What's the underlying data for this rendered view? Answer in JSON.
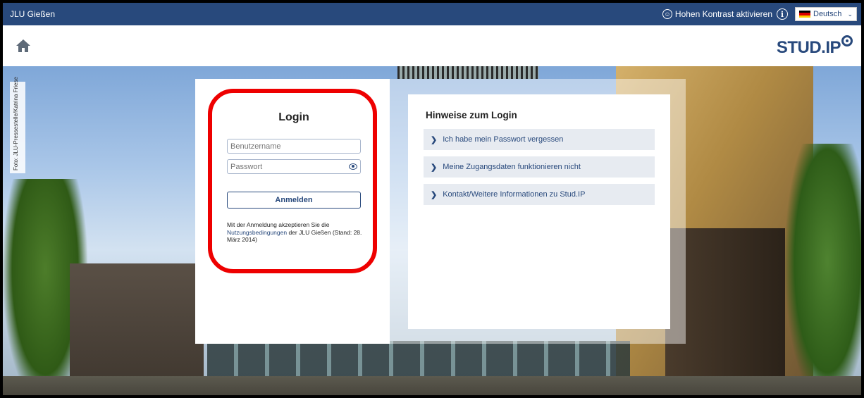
{
  "topbar": {
    "brand": "JLU Gießen",
    "contrast_label": "Hohen Kontrast aktivieren",
    "language": "Deutsch"
  },
  "header": {
    "logo_text": "STUD.IP"
  },
  "photo_credit": "Foto: JLU-Pressestelle/Katrina Friese",
  "login": {
    "title": "Login",
    "username_placeholder": "Benutzername",
    "password_placeholder": "Passwort",
    "button_label": "Anmelden",
    "terms_prefix": "Mit der Anmeldung akzeptieren Sie die",
    "terms_link": "Nutzungsbedingungen",
    "terms_suffix": "der JLU Gießen (Stand: 28. März 2014)"
  },
  "hints": {
    "title": "Hinweise zum Login",
    "items": [
      {
        "label": "Ich habe mein Passwort vergessen"
      },
      {
        "label": "Meine Zugangsdaten funktionieren nicht"
      },
      {
        "label": "Kontakt/Weitere Informationen zu Stud.IP"
      }
    ]
  },
  "colors": {
    "brand_blue": "#28497c",
    "highlight_red": "#ee0000",
    "hint_bg": "#e7ebf1"
  },
  "icons": {
    "home": "home-icon",
    "accessibility": "accessibility-icon",
    "info": "info-icon",
    "flag": "german-flag-icon",
    "show_password": "eye-icon",
    "chevron": "chevron-right-icon"
  }
}
